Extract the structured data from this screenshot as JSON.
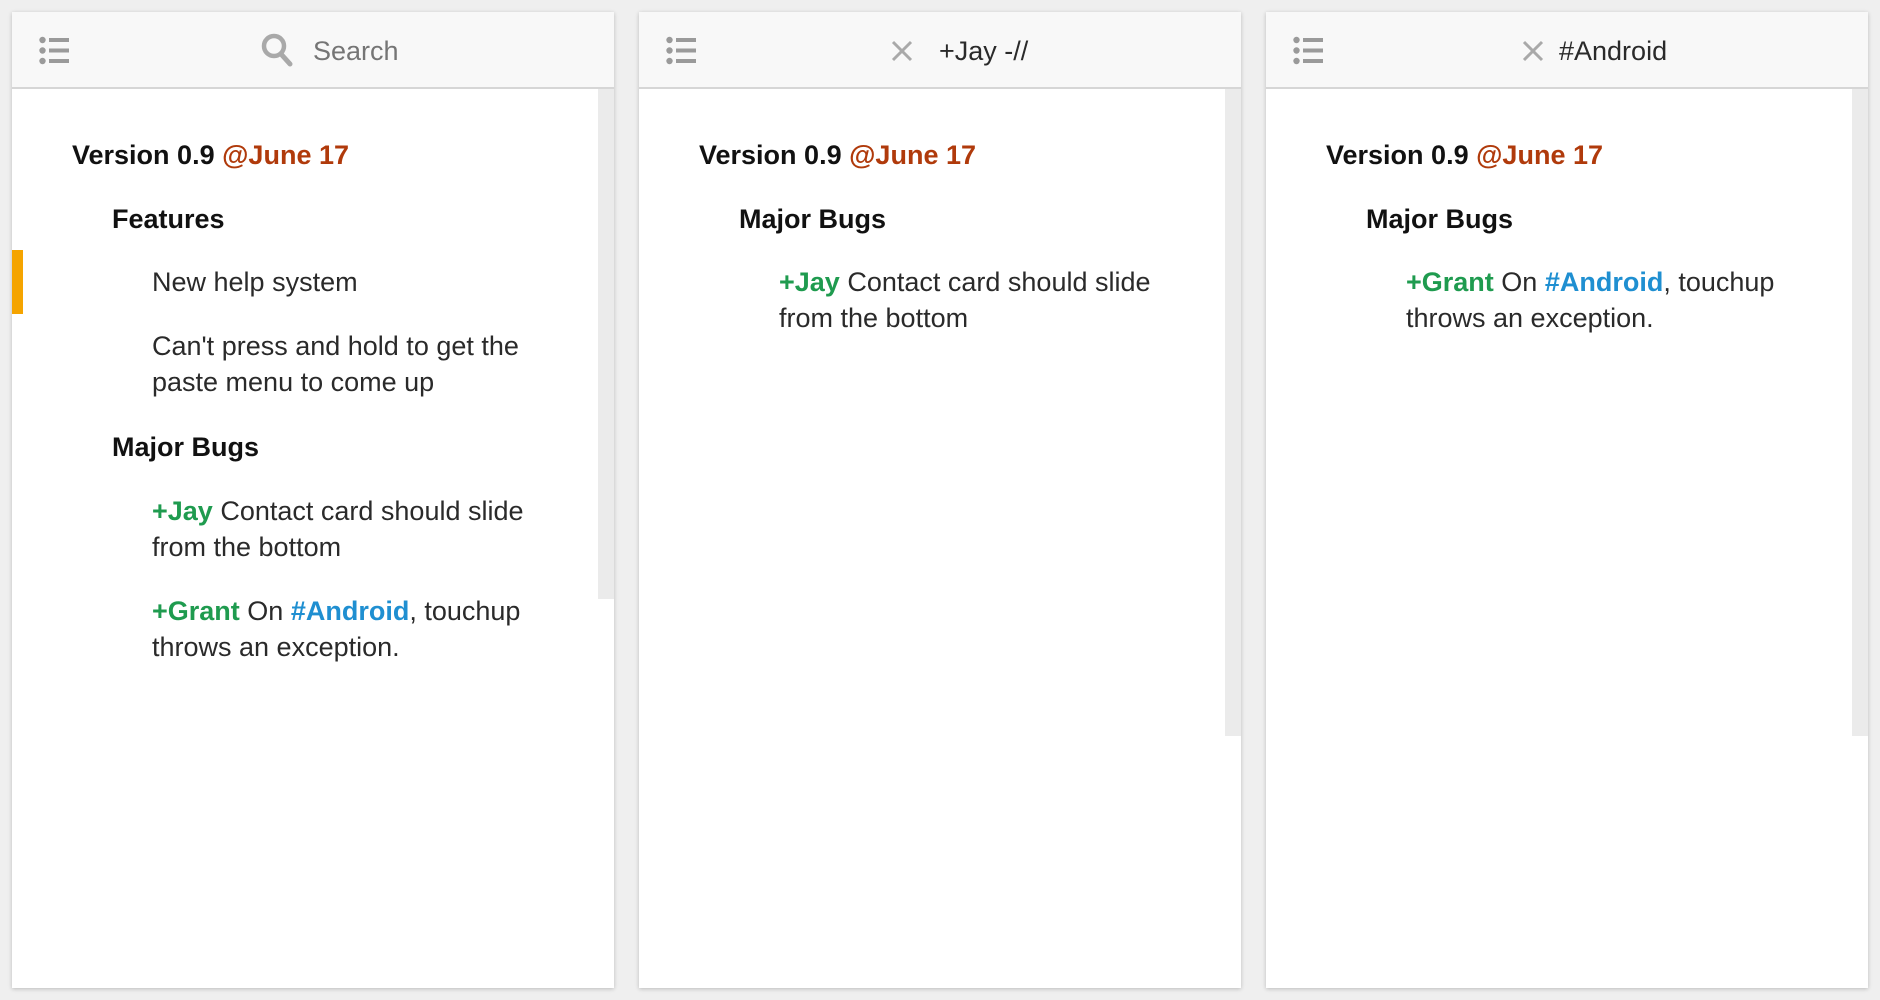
{
  "panels": [
    {
      "search_placeholder": "Search",
      "items": {
        "version": "Version 0.9",
        "date": "@June 17",
        "features": "Features",
        "feature_1": "New help system",
        "feature_2_line1": "Can't press and hold to get the",
        "feature_2_line2": "paste menu to come up",
        "major_bugs": "Major Bugs",
        "bug_1_person": "+Jay",
        "bug_1_text": " Contact card should slide",
        "bug_1_line2": "from the bottom",
        "bug_2_person": "+Grant",
        "bug_2_text": " On ",
        "bug_2_tag": "#Android",
        "bug_2_rest": ", touchup",
        "bug_2_line2": "throws an exception."
      }
    },
    {
      "query": "+Jay -//",
      "items": {
        "version": "Version 0.9",
        "date": "@June 17",
        "major_bugs": "Major Bugs",
        "bug_1_person": "+Jay",
        "bug_1_text": " Contact card should slide",
        "bug_1_line2": "from the bottom"
      }
    },
    {
      "query": "#Android",
      "items": {
        "version": "Version 0.9",
        "date": "@June 17",
        "major_bugs": "Major Bugs",
        "bug_2_person": "+Grant",
        "bug_2_text": " On ",
        "bug_2_tag": "#Android",
        "bug_2_rest": ", touchup",
        "bug_2_line2": "throws an exception."
      }
    }
  ],
  "colors": {
    "date": "#b03a0b",
    "person": "#1f9b4f",
    "tag": "#1f8fd1",
    "cursor": "#f5a400"
  },
  "icons": {
    "menu": "list-menu-icon",
    "search": "search-icon",
    "clear": "close-icon"
  }
}
